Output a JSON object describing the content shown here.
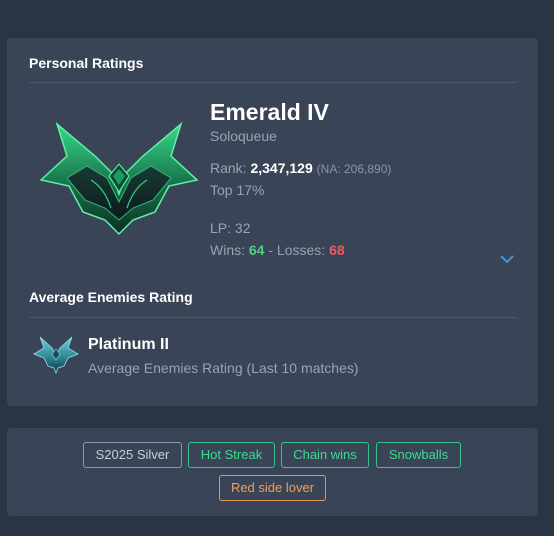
{
  "ratings": {
    "section_title": "Personal Ratings",
    "rank_title": "Emerald IV",
    "queue": "Soloqueue",
    "rank_label": "Rank:",
    "rank_value": "2,347,129",
    "rank_region": "(NA: 206,890)",
    "top_percent": "Top 17%",
    "lp_text": "LP: 32",
    "wins_label": "Wins:",
    "wins_value": "64",
    "separator": "-",
    "losses_label": "Losses:",
    "losses_value": "68",
    "emblem_icon": "emerald-emblem-icon",
    "expand_icon": "chevron-down-icon"
  },
  "enemies": {
    "section_title": "Average Enemies Rating",
    "rank": "Platinum II",
    "subtitle": "Average Enemies Rating (Last 10 matches)",
    "emblem_icon": "platinum-emblem-icon"
  },
  "tags": [
    {
      "label": "S2025 Silver",
      "style": "grey"
    },
    {
      "label": "Hot Streak",
      "style": "green"
    },
    {
      "label": "Chain wins",
      "style": "green"
    },
    {
      "label": "Snowballs",
      "style": "green"
    },
    {
      "label": "Red side lover",
      "style": "orange"
    }
  ],
  "colors": {
    "background": "#2b3443",
    "card": "#3a4457",
    "win": "#4cd27d",
    "loss": "#ef5a62",
    "tag_green": "#36c585",
    "tag_orange": "#e39450",
    "tag_grey": "#8e97a8",
    "accent_blue": "#4d94d6"
  }
}
